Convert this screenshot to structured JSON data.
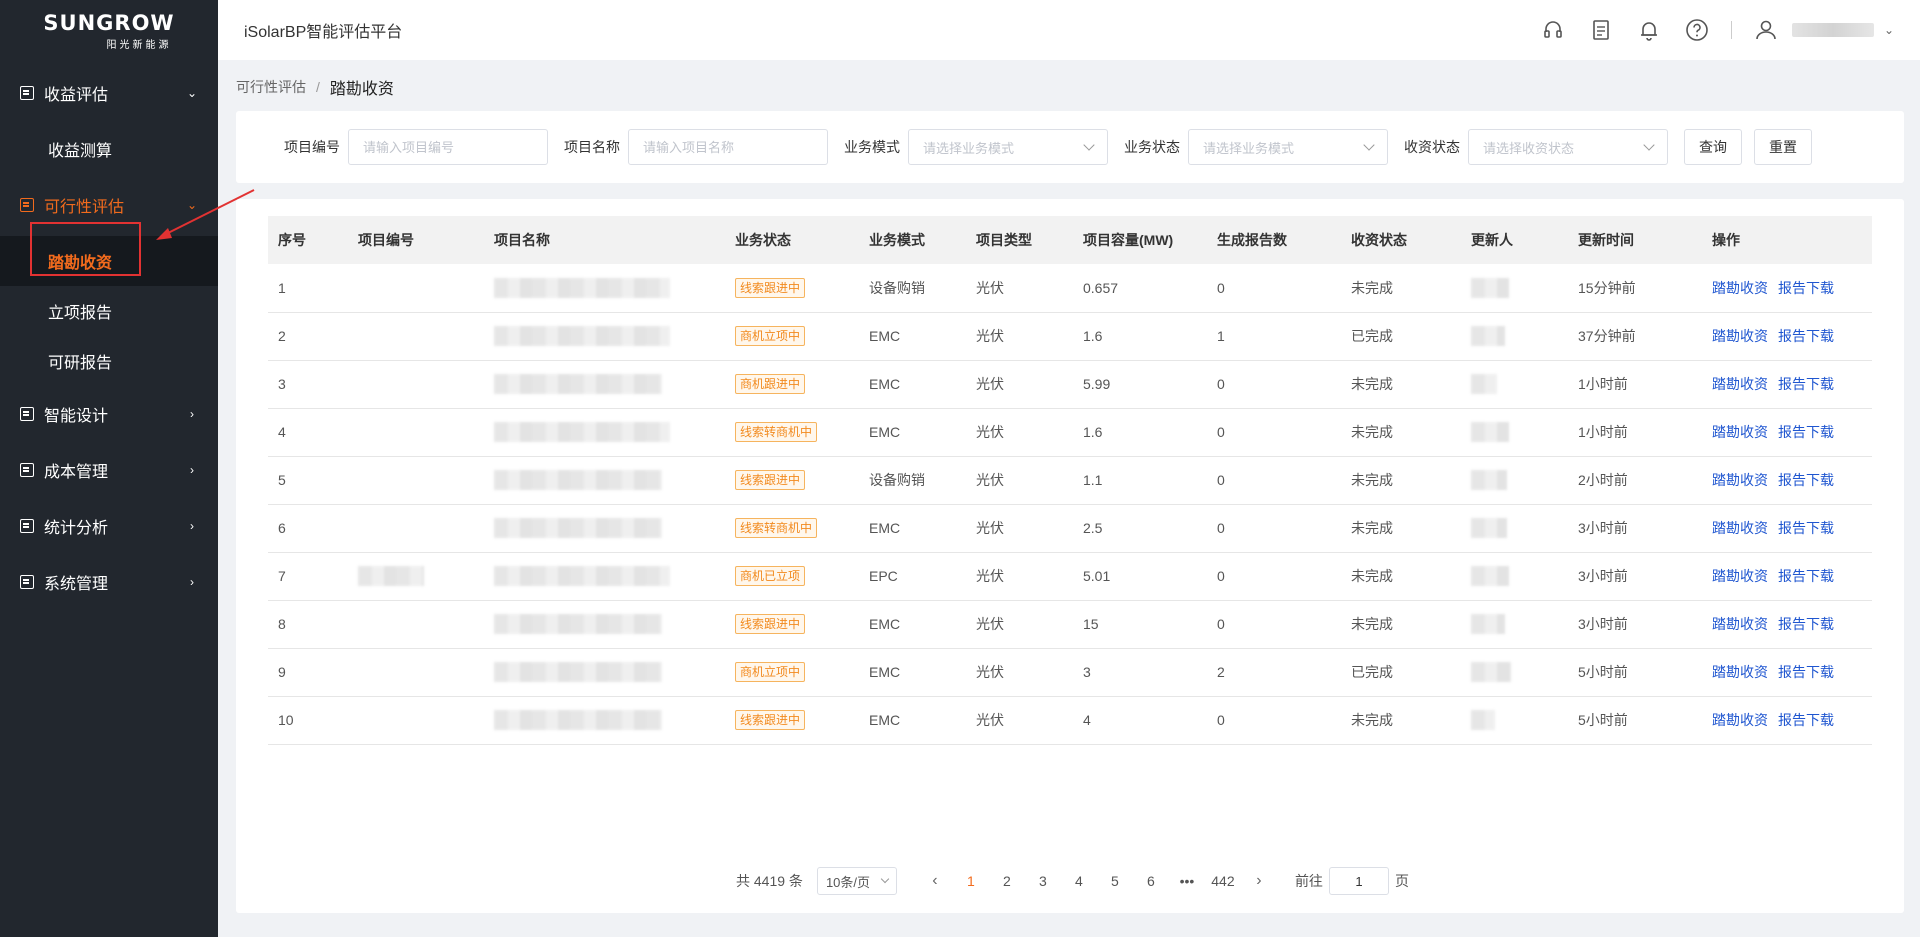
{
  "logo": {
    "brand": "SUNGROW",
    "sub": "阳光新能源"
  },
  "sidebar": {
    "groups": [
      {
        "label": "收益评估",
        "arrow": "⌄",
        "icon": "report-icon",
        "children": [
          "收益测算"
        ]
      },
      {
        "label": "可行性评估",
        "arrow": "⌄",
        "icon": "folder-icon",
        "children": [
          "踏勘收资",
          "立项报告",
          "可研报告"
        ]
      },
      {
        "label": "智能设计",
        "arrow": "›",
        "icon": "design-icon"
      },
      {
        "label": "成本管理",
        "arrow": "›",
        "icon": "cost-icon"
      },
      {
        "label": "统计分析",
        "arrow": "›",
        "icon": "stats-icon"
      },
      {
        "label": "系统管理",
        "arrow": "›",
        "icon": "system-icon"
      }
    ]
  },
  "header": {
    "title": "iSolarBP智能评估平台",
    "icons": [
      "headset-icon",
      "document-icon",
      "bell-icon",
      "help-icon",
      "user-icon"
    ]
  },
  "breadcrumb": {
    "parent": "可行性评估",
    "separator": "/",
    "current": "踏勘收资"
  },
  "filters": {
    "project_no": {
      "label": "项目编号",
      "placeholder": "请输入项目编号"
    },
    "project_name": {
      "label": "项目名称",
      "placeholder": "请输入项目名称"
    },
    "biz_mode": {
      "label": "业务模式",
      "placeholder": "请选择业务模式"
    },
    "biz_status": {
      "label": "业务状态",
      "placeholder": "请选择业务模式"
    },
    "collect_status": {
      "label": "收资状态",
      "placeholder": "请选择收资状态"
    },
    "query_button": "查询",
    "reset_button": "重置"
  },
  "table": {
    "columns": [
      "序号",
      "项目编号",
      "项目名称",
      "业务状态",
      "业务模式",
      "项目类型",
      "项目容量(MW)",
      "生成报告数",
      "收资状态",
      "更新人",
      "更新时间",
      "操作"
    ],
    "rows": [
      {
        "no": "1",
        "status": "线索跟进中",
        "mode": "设备购销",
        "type": "光伏",
        "capacity": "0.657",
        "reports": "0",
        "collect": "未完成",
        "time": "15分钟前"
      },
      {
        "no": "2",
        "status": "商机立项中",
        "mode": "EMC",
        "type": "光伏",
        "capacity": "1.6",
        "reports": "1",
        "collect": "已完成",
        "time": "37分钟前"
      },
      {
        "no": "3",
        "status": "商机跟进中",
        "mode": "EMC",
        "type": "光伏",
        "capacity": "5.99",
        "reports": "0",
        "collect": "未完成",
        "time": "1小时前"
      },
      {
        "no": "4",
        "status": "线索转商机中",
        "mode": "EMC",
        "type": "光伏",
        "capacity": "1.6",
        "reports": "0",
        "collect": "未完成",
        "time": "1小时前"
      },
      {
        "no": "5",
        "status": "线索跟进中",
        "mode": "设备购销",
        "type": "光伏",
        "capacity": "1.1",
        "reports": "0",
        "collect": "未完成",
        "time": "2小时前"
      },
      {
        "no": "6",
        "status": "线索转商机中",
        "mode": "EMC",
        "type": "光伏",
        "capacity": "2.5",
        "reports": "0",
        "collect": "未完成",
        "time": "3小时前"
      },
      {
        "no": "7",
        "status": "商机已立项",
        "mode": "EPC",
        "type": "光伏",
        "capacity": "5.01",
        "reports": "0",
        "collect": "未完成",
        "time": "3小时前"
      },
      {
        "no": "8",
        "status": "线索跟进中",
        "mode": "EMC",
        "type": "光伏",
        "capacity": "15",
        "reports": "0",
        "collect": "未完成",
        "time": "3小时前"
      },
      {
        "no": "9",
        "status": "商机立项中",
        "mode": "EMC",
        "type": "光伏",
        "capacity": "3",
        "reports": "2",
        "collect": "已完成",
        "time": "5小时前"
      },
      {
        "no": "10",
        "status": "线索跟进中",
        "mode": "EMC",
        "type": "光伏",
        "capacity": "4",
        "reports": "0",
        "collect": "未完成",
        "time": "5小时前"
      }
    ],
    "actions": [
      "踏勘收资",
      "报告下载"
    ]
  },
  "pagination": {
    "total": "共 4419 条",
    "page_size": "10条/页",
    "prev": "‹",
    "next": "›",
    "pages": [
      "1",
      "2",
      "3",
      "4",
      "5",
      "6",
      "•••",
      "442"
    ],
    "current": "1",
    "goto_label": "前往",
    "goto_value": "1",
    "page_unit": "页"
  }
}
